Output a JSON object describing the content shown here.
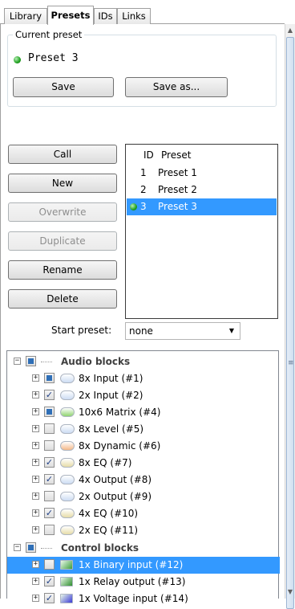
{
  "tabs": [
    {
      "label": "Library",
      "active": false
    },
    {
      "label": "Presets",
      "active": true
    },
    {
      "label": "IDs",
      "active": false
    },
    {
      "label": "Links",
      "active": false
    }
  ],
  "current_preset": {
    "group_title": "Current preset",
    "name": "Preset 3",
    "save_label": "Save",
    "save_as_label": "Save as..."
  },
  "actions": {
    "call": "Call",
    "new": "New",
    "overwrite": "Overwrite",
    "duplicate": "Duplicate",
    "rename": "Rename",
    "delete": "Delete"
  },
  "preset_table": {
    "headers": {
      "id": "ID",
      "name": "Preset"
    },
    "rows": [
      {
        "id": "1",
        "name": "Preset 1"
      },
      {
        "id": "2",
        "name": "Preset 2"
      },
      {
        "id": "3",
        "name": "Preset 3"
      }
    ]
  },
  "start_preset": {
    "label": "Start preset:",
    "value": "none"
  },
  "tree": {
    "audio_label": "Audio blocks",
    "audio_items": [
      {
        "label": "8x Input (#1)",
        "check": "partial",
        "pill_color": "#cddcf3"
      },
      {
        "label": "2x Input (#2)",
        "check": "checked",
        "pill_color": "#cddcf3"
      },
      {
        "label": "10x6 Matrix (#4)",
        "check": "partial",
        "pill_color": "#8fd46f"
      },
      {
        "label": "8x Level (#5)",
        "check": "unchecked",
        "pill_color": "#cddcf3"
      },
      {
        "label": "8x Dynamic (#6)",
        "check": "unchecked",
        "pill_color": "#f4b888"
      },
      {
        "label": "8x EQ (#7)",
        "check": "checked",
        "pill_color": "#e6dca8"
      },
      {
        "label": "4x Output (#8)",
        "check": "checked",
        "pill_color": "#cddcf3"
      },
      {
        "label": "2x Output (#9)",
        "check": "unchecked",
        "pill_color": "#cddcf3"
      },
      {
        "label": "4x EQ (#10)",
        "check": "checked",
        "pill_color": "#e6dca8"
      },
      {
        "label": "2x EQ (#11)",
        "check": "unchecked",
        "pill_color": "#e6dca8"
      }
    ],
    "control_label": "Control blocks",
    "control_items": [
      {
        "label": "1x Binary input (#12)",
        "check": "unchecked",
        "icon_color": "#3e9e3e"
      },
      {
        "label": "1x Relay output (#13)",
        "check": "checked",
        "icon_color": "#2f8f2f"
      },
      {
        "label": "1x Voltage input (#14)",
        "check": "checked",
        "icon_color": "#3b3bd6"
      }
    ]
  }
}
